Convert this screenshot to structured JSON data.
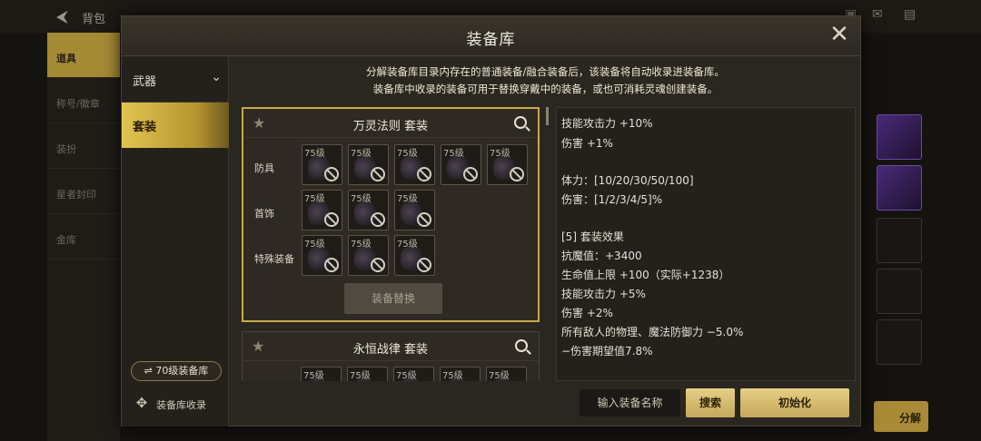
{
  "background": {
    "title": "背包",
    "left_menu": [
      "道具",
      "称号/徽章",
      "装扮",
      "星者封印",
      "金库"
    ],
    "split_label": "分解"
  },
  "modal": {
    "title": "装备库",
    "notice": {
      "line1_pre": "分解装备库目录内存在的普通装备/融合装备后，该装备将自动收录进装备库。",
      "line2": "装备库中收录的装备可用于替换穿戴中的装备，或也可消耗灵魂创建装备。"
    },
    "sidebar": {
      "categories": [
        {
          "label": "武器"
        },
        {
          "label": "套装"
        }
      ],
      "level_button": "⇌ 70级装备库",
      "collect_label": "装备库收录"
    },
    "sets": [
      {
        "name": "万灵法则  套装",
        "rows": [
          {
            "label": "防具",
            "slots": [
              "75级",
              "75级",
              "75级",
              "75级",
              "75级"
            ]
          },
          {
            "label": "首饰",
            "slots": [
              "75级",
              "75级",
              "75级"
            ]
          },
          {
            "label": "特殊装备",
            "slots": [
              "75级",
              "75级",
              "75级"
            ]
          }
        ],
        "replace_button": "装备替换"
      },
      {
        "name": "永恒战律  套装",
        "rows": [
          {
            "label": "",
            "slots": [
              "75级",
              "75级",
              "75级",
              "75级",
              "75级"
            ]
          }
        ]
      }
    ],
    "detail_lines": [
      "技能攻击力 +10%",
      "伤害 +1%",
      "",
      "体力：[10/20/30/50/100]",
      "伤害：[1/2/3/4/5]%",
      "",
      "[5] 套装效果",
      "抗魔值：+3400",
      "生命值上限 +100（实际+1238）",
      "技能攻击力 +5%",
      "伤害 +2%",
      "所有敌人的物理、魔法防御力 −5.0%",
      "−伤害期望值7.8%"
    ],
    "search": {
      "placeholder": "输入装备名称",
      "search_button": "搜索",
      "reset_button": "初始化"
    }
  }
}
